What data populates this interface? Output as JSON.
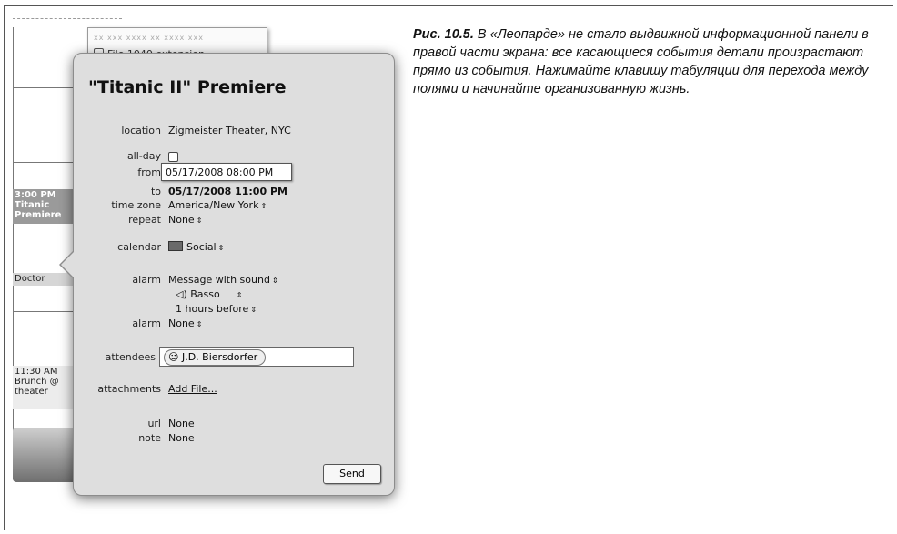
{
  "caption": {
    "figure_label": "Рис. 10.5.",
    "text": " В «Леопарде» не стало выдвижной информационной панели в правой части экрана: все касающиеся события детали произрастают прямо из события. Нажимайте клавишу табуляции для перехода между полями и начинайте организованную жизнь."
  },
  "background_calendar": {
    "behind_item_faint": "xx xxx xxxx xx xxxx xxx",
    "behind_item": "File 1040 extension",
    "event_1": [
      "3:00 PM",
      "Titanic",
      "Premiere"
    ],
    "event_2": "Doctor",
    "event_3": [
      "11:30 AM",
      "Brunch @",
      "theater"
    ]
  },
  "event": {
    "title": "\"Titanic II\" Premiere",
    "fields": {
      "location_label": "location",
      "location_value": "Zigmeister Theater, NYC",
      "allday_label": "all-day",
      "from_label": "from",
      "from_value": "05/17/2008 08:00 PM",
      "to_label": "to",
      "to_value": "05/17/2008 11:00 PM",
      "timezone_label": "time zone",
      "timezone_value": "America/New York",
      "repeat_label": "repeat",
      "repeat_value": "None",
      "calendar_label": "calendar",
      "calendar_value": "Social",
      "alarm1_label": "alarm",
      "alarm1_value": "Message with sound",
      "alarm1_sound": "Basso",
      "alarm1_time": "1 hours before",
      "alarm2_label": "alarm",
      "alarm2_value": "None",
      "attendees_label": "attendees",
      "attendee_1": "J.D. Biersdorfer",
      "attachments_label": "attachments",
      "attachments_link": "Add File...",
      "url_label": "url",
      "url_value": "None",
      "note_label": "note",
      "note_value": "None"
    },
    "send_label": "Send"
  },
  "icons": {
    "popup_arrows": "updown-arrows-icon",
    "speaker": "speaker-icon",
    "person": "person-icon"
  }
}
